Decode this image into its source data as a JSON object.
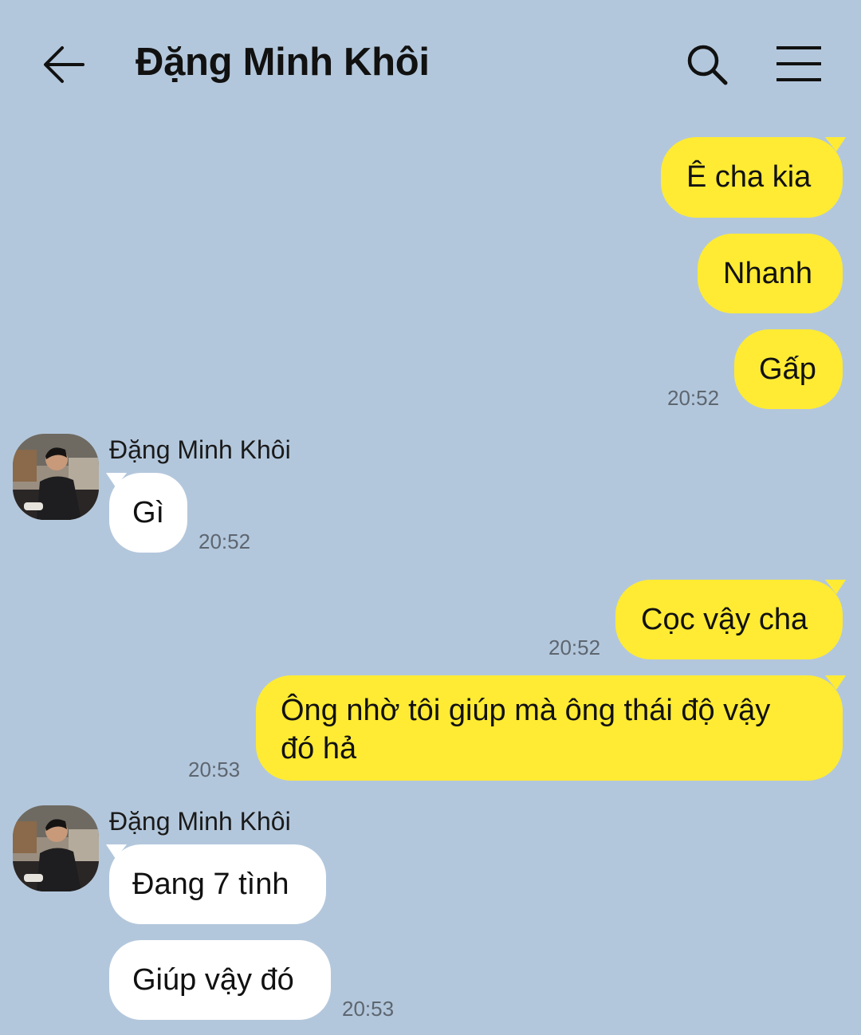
{
  "header": {
    "title": "Đặng Minh Khôi",
    "back_icon": "arrow-left-icon",
    "search_icon": "search-icon",
    "menu_icon": "menu-icon"
  },
  "colors": {
    "background": "#b3c7dc",
    "outgoing_bubble": "#ffeb33",
    "incoming_bubble": "#ffffff",
    "timestamp": "#5d6670"
  },
  "messages": [
    {
      "direction": "out",
      "text": "Ê cha kia"
    },
    {
      "direction": "out",
      "text": "Nhanh"
    },
    {
      "direction": "out",
      "text": "Gấp",
      "time": "20:52"
    },
    {
      "direction": "in",
      "sender": "Đặng Minh Khôi",
      "text": "Gì",
      "time": "20:52"
    },
    {
      "direction": "out",
      "text": "Cọc vậy cha",
      "time": "20:52"
    },
    {
      "direction": "out",
      "text_lines": [
        "Ông nhờ tôi giúp mà ông thái độ vậy",
        "đó hả"
      ],
      "time": "20:53"
    },
    {
      "direction": "in",
      "sender": "Đặng Minh Khôi",
      "text": "Đang 7 tình"
    },
    {
      "direction": "in",
      "text": "Giúp vậy đó",
      "time": "20:53"
    }
  ]
}
